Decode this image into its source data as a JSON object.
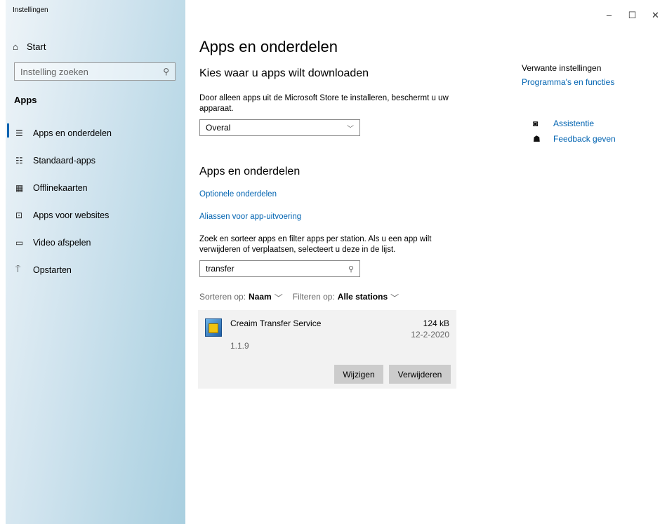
{
  "window": {
    "title": "Instellingen",
    "controls": {
      "minimize": "–",
      "maximize": "☐",
      "close": "✕"
    }
  },
  "sidebar": {
    "home_label": "Start",
    "search_placeholder": "Instelling zoeken",
    "section_label": "Apps",
    "items": [
      {
        "label": "Apps en onderdelen",
        "icon": "apps-features-icon",
        "selected": true
      },
      {
        "label": "Standaard-apps",
        "icon": "default-apps-icon"
      },
      {
        "label": "Offlinekaarten",
        "icon": "offline-maps-icon"
      },
      {
        "label": "Apps voor websites",
        "icon": "apps-websites-icon"
      },
      {
        "label": "Video afspelen",
        "icon": "video-playback-icon"
      },
      {
        "label": "Opstarten",
        "icon": "startup-icon"
      }
    ]
  },
  "main": {
    "page_title": "Apps en onderdelen",
    "download_heading": "Kies waar u apps wilt downloaden",
    "download_desc": "Door alleen apps uit de Microsoft Store te installeren, beschermt u uw apparaat.",
    "download_select_value": "Overal",
    "apps_heading": "Apps en onderdelen",
    "optional_link": "Optionele onderdelen",
    "alias_link": "Aliassen voor app-uitvoering",
    "search_desc": "Zoek en sorteer apps en filter apps per station. Als u een app wilt verwijderen of verplaatsen, selecteert u deze in de lijst.",
    "search_value": "transfer",
    "sort_prefix": "Sorteren op:",
    "sort_value": "Naam",
    "filter_prefix": "Filteren op:",
    "filter_value": "Alle stations",
    "app": {
      "name": "Creaim Transfer Service",
      "size": "124 kB",
      "date": "12-2-2020",
      "version": "1.1.9",
      "modify_label": "Wijzigen",
      "remove_label": "Verwijderen"
    }
  },
  "related": {
    "title": "Verwante instellingen",
    "link": "Programma's en functies"
  },
  "support": {
    "help_label": "Assistentie",
    "feedback_label": "Feedback geven"
  },
  "colors": {
    "accent": "#0063b1",
    "sidebar_gradient_end": "#a9cfe0",
    "app_card_bg": "#f2f2f2",
    "button_bg": "#cccccc"
  }
}
